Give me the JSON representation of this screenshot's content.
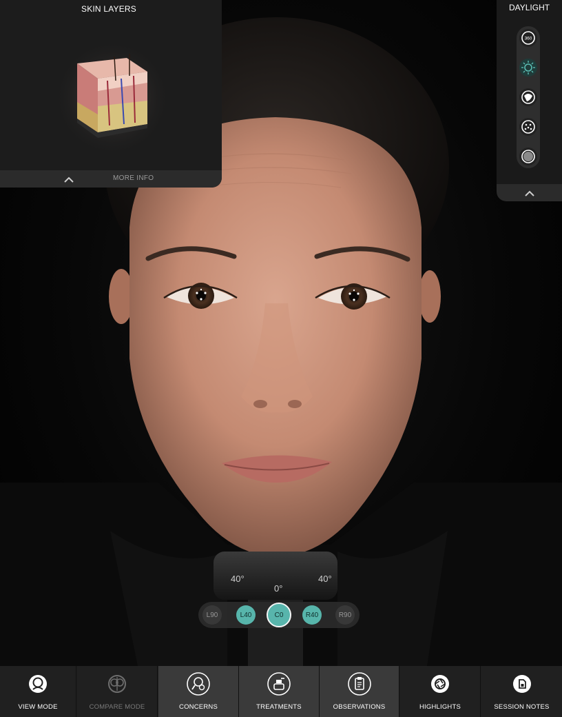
{
  "skin_panel": {
    "title": "SKIN LAYERS",
    "more_info_label": "MORE INFO",
    "thumbnail_icon": "skin-layers-cross-section"
  },
  "light_panel": {
    "title": "DAYLIGHT",
    "modes": [
      {
        "icon": "360-view-icon",
        "active": false
      },
      {
        "icon": "daylight-sun-icon",
        "active": true
      },
      {
        "icon": "cross-polarized-icon",
        "active": false
      },
      {
        "icon": "uv-spots-icon",
        "active": false
      },
      {
        "icon": "red-area-icon",
        "active": false
      }
    ]
  },
  "angle_selector": {
    "options": [
      {
        "label": "L90",
        "state": "inactive"
      },
      {
        "label": "L40",
        "state": "available"
      },
      {
        "label": "C0",
        "state": "selected"
      },
      {
        "label": "R40",
        "state": "available"
      },
      {
        "label": "R90",
        "state": "inactive"
      }
    ]
  },
  "chin_rest_labels": {
    "left": "40°",
    "center": "0°",
    "right": "40°"
  },
  "toolbar": {
    "items": [
      {
        "label": "VIEW MODE",
        "icon": "view-mode-icon"
      },
      {
        "label": "COMPARE MODE",
        "icon": "compare-mode-icon"
      },
      {
        "label": "CONCERNS",
        "icon": "concerns-icon"
      },
      {
        "label": "TREATMENTS",
        "icon": "treatments-icon"
      },
      {
        "label": "OBSERVATIONS",
        "icon": "observations-icon"
      },
      {
        "label": "HIGHLIGHTS",
        "icon": "highlights-icon"
      },
      {
        "label": "SESSION NOTES",
        "icon": "session-notes-icon"
      }
    ]
  },
  "colors": {
    "accent_teal": "#5bbcb2",
    "panel_bg": "#1c1c1c",
    "toolbar_bg": "#202020",
    "toolbar_group_bg": "#3a3a3a"
  }
}
